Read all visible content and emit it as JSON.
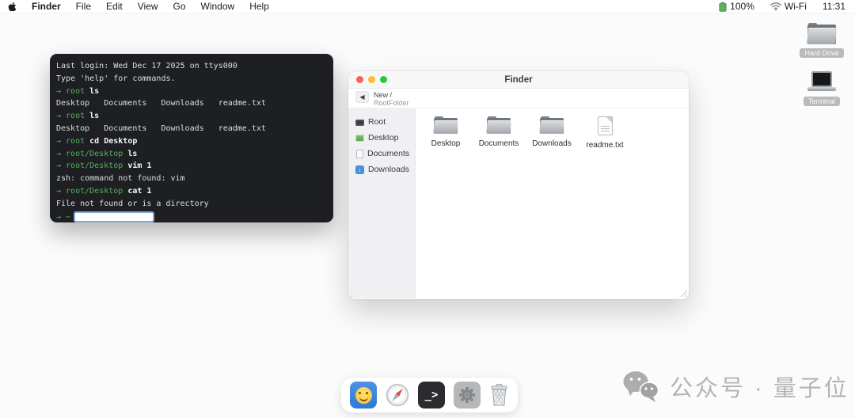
{
  "menu_bar": {
    "items": [
      "Finder",
      "File",
      "Edit",
      "View",
      "Go",
      "Window",
      "Help"
    ],
    "battery": "100%",
    "network": "Wi-Fi",
    "clock": "11:31"
  },
  "terminal": {
    "lines": [
      {
        "segments": [
          {
            "text": "Last login: Wed Dec 17 2025 on ttys000",
            "style": "plain"
          }
        ]
      },
      {
        "segments": [
          {
            "text": "Type 'help' for commands.",
            "style": "plain"
          }
        ]
      },
      {
        "segments": [
          {
            "text": "→ root ",
            "style": "prompt"
          },
          {
            "text": "ls",
            "style": "cmd"
          }
        ]
      },
      {
        "segments": [
          {
            "text": "Desktop   Documents   Downloads   readme.txt",
            "style": "plain"
          }
        ]
      },
      {
        "segments": [
          {
            "text": "→ root ",
            "style": "prompt"
          },
          {
            "text": "ls",
            "style": "cmd"
          }
        ]
      },
      {
        "segments": [
          {
            "text": "Desktop   Documents   Downloads   readme.txt",
            "style": "plain"
          }
        ]
      },
      {
        "segments": [
          {
            "text": "→ root ",
            "style": "prompt"
          },
          {
            "text": "cd Desktop",
            "style": "cmd"
          }
        ]
      },
      {
        "segments": [
          {
            "text": "→ root/Desktop ",
            "style": "prompt"
          },
          {
            "text": "ls",
            "style": "cmd"
          }
        ]
      },
      {
        "segments": [
          {
            "text": "→ root/Desktop ",
            "style": "prompt"
          },
          {
            "text": "vim 1",
            "style": "cmd"
          }
        ]
      },
      {
        "segments": [
          {
            "text": "zsh: command not found: vim",
            "style": "plain"
          }
        ]
      },
      {
        "segments": [
          {
            "text": "→ root/Desktop ",
            "style": "prompt"
          },
          {
            "text": "cat 1",
            "style": "cmd"
          }
        ]
      },
      {
        "segments": [
          {
            "text": "File not found or is a directory",
            "style": "plain"
          }
        ]
      }
    ],
    "prompt_arrow": "→ ~",
    "input_value": ""
  },
  "finder": {
    "title": "Finder",
    "toolbar": {
      "back_icon": "◀",
      "nav_line1": "New /",
      "nav_line2": "RootFolder"
    },
    "sidebar_items": [
      {
        "label": "Root"
      },
      {
        "label": "Desktop"
      },
      {
        "label": "Documents"
      },
      {
        "label": "Downloads"
      }
    ],
    "files": [
      {
        "label": "Desktop",
        "type": "folder"
      },
      {
        "label": "Documents",
        "type": "folder"
      },
      {
        "label": "Downloads",
        "type": "folder"
      },
      {
        "label": "readme.txt",
        "type": "file"
      }
    ]
  },
  "desktop_icons": [
    {
      "label": "Hard Drive",
      "type": "folder"
    },
    {
      "label": "Terminal",
      "type": "laptop"
    }
  ],
  "dock": {
    "items": [
      {
        "name": "finder-app",
        "icon": "smiley"
      },
      {
        "name": "safari",
        "icon": "compass"
      },
      {
        "name": "terminal-app",
        "icon": "terminal",
        "glyph": "_>"
      },
      {
        "name": "settings",
        "icon": "gear"
      },
      {
        "name": "trash",
        "icon": "trash"
      }
    ]
  },
  "watermark": {
    "text": "公众号 · 量子位"
  },
  "download_arrow": "↓"
}
